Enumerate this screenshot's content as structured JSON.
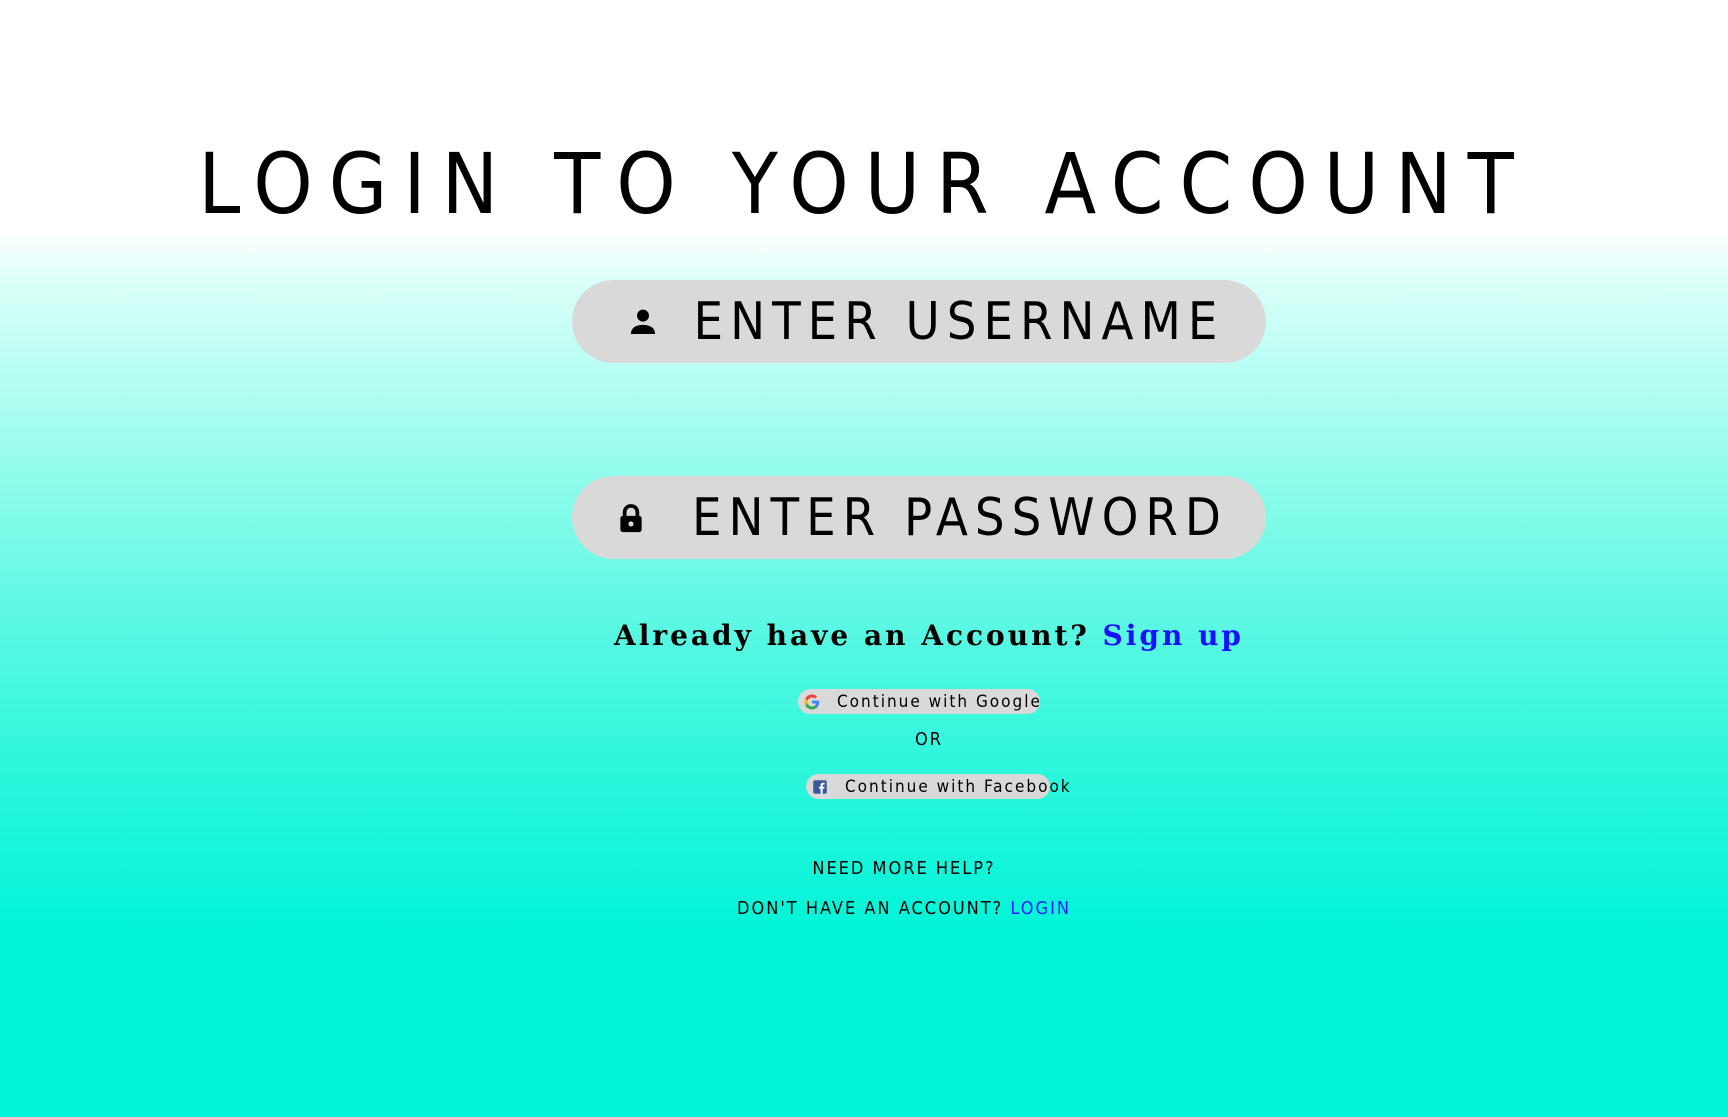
{
  "title": "Login to your account",
  "username": {
    "placeholder": "Enter Username",
    "icon": "person-icon"
  },
  "password": {
    "placeholder": "Enter Password",
    "icon": "lock-icon"
  },
  "account_prompt": {
    "text": "Already have an Account? ",
    "link": "Sign up"
  },
  "social": {
    "google_label": "Continue with Google",
    "google_icon": "google-icon",
    "separator": "OR",
    "facebook_label": "Continue with Facebook",
    "facebook_icon": "facebook-icon"
  },
  "footer": {
    "help": "Need more help?",
    "no_account_text": "Don't have an account? ",
    "no_account_link": "Login"
  },
  "colors": {
    "link": "#1a10ff",
    "field_bg": "#d9d9d9",
    "gradient_bottom": "#00f4d7"
  }
}
